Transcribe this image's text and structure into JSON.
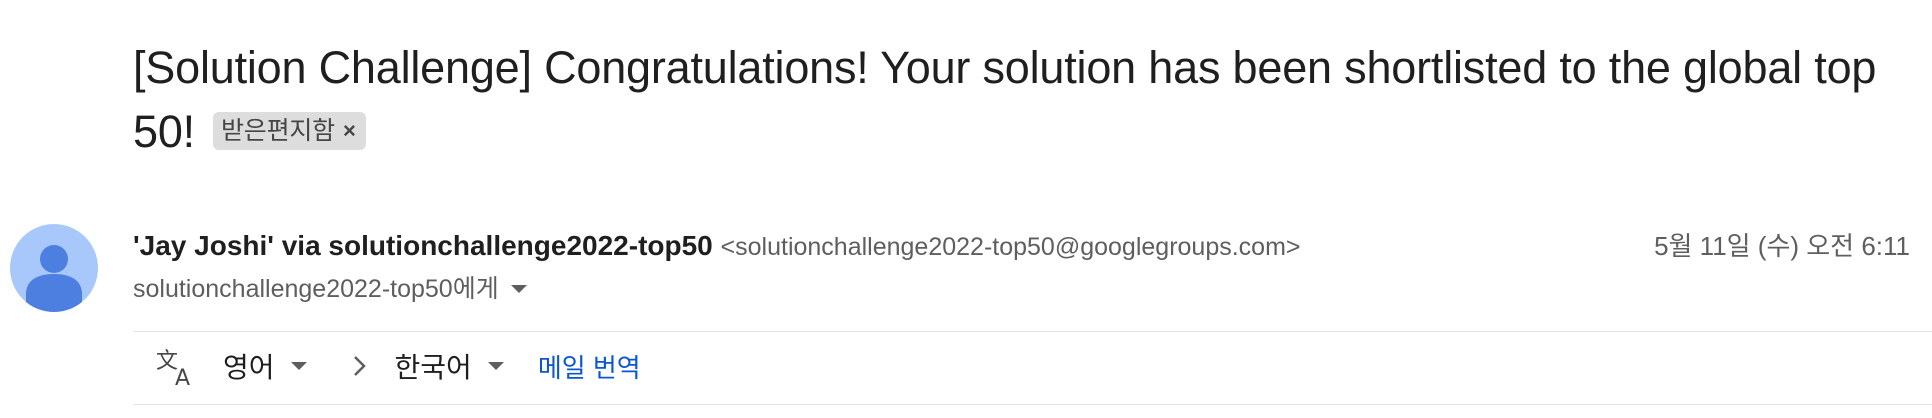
{
  "email": {
    "subject": "[Solution Challenge] Congratulations! Your solution has been shortlisted to the global top 50!",
    "label_chip": "받은편지함",
    "label_close": "×",
    "sender_name": "'Jay Joshi' via solutionchallenge2022-top50",
    "sender_email": "<solutionchallenge2022-top50@googlegroups.com>",
    "date": "5월 11일 (수) 오전 6:11",
    "recipient": "solutionchallenge2022-top50에게"
  },
  "translate": {
    "icon": "translate-icon",
    "source_lang": "영어",
    "separator_icon": "chevron-right-icon",
    "target_lang": "한국어",
    "action": "메일 번역"
  },
  "colors": {
    "avatar_bg": "#a8c7fa",
    "avatar_fg": "#4d7fe0",
    "link": "#0b57d0",
    "chip_bg": "#dddddd"
  }
}
